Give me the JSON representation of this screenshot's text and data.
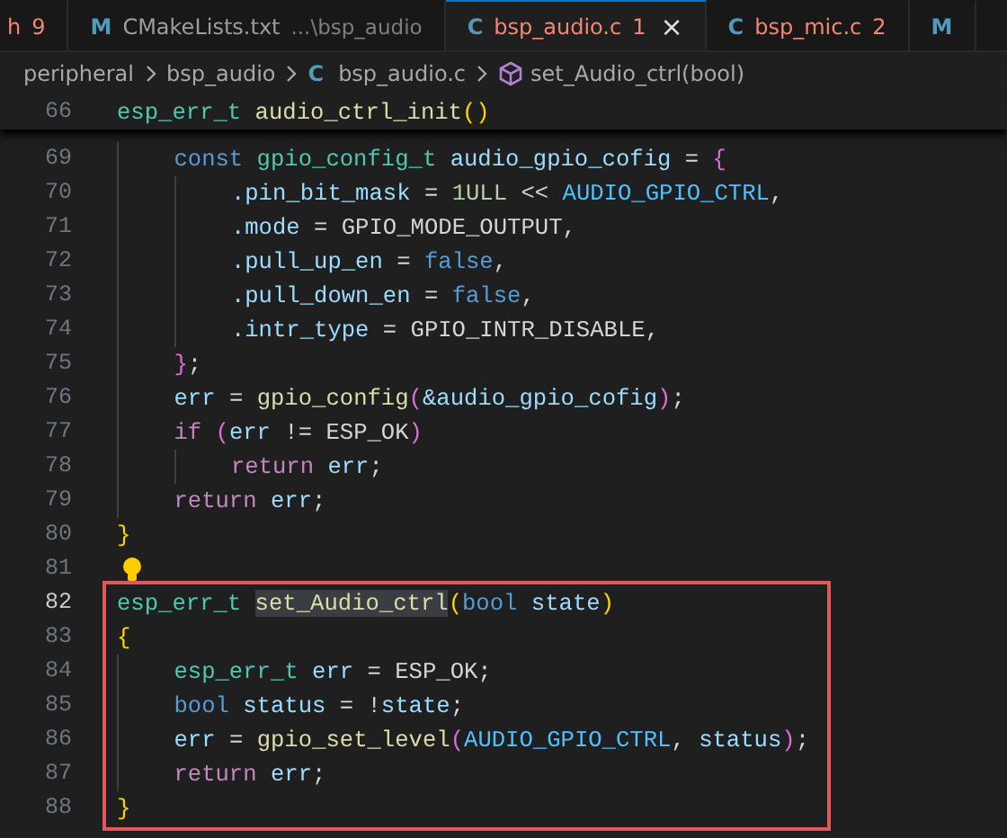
{
  "tabs": [
    {
      "label": "h",
      "badge": "9",
      "error": true,
      "selected": false
    },
    {
      "icon": "M",
      "label": "CMakeLists.txt",
      "description": "...\\bsp_audio",
      "error": false,
      "selected": false
    },
    {
      "icon": "C",
      "label": "bsp_audio.c",
      "badge": "1",
      "error": true,
      "selected": true,
      "close": "×"
    },
    {
      "icon": "C",
      "label": "bsp_mic.c",
      "badge": "2",
      "error": true,
      "selected": false
    },
    {
      "icon": "M",
      "selected": false
    }
  ],
  "breadcrumb": [
    {
      "kind": "folder",
      "label": "peripheral"
    },
    {
      "kind": "folder",
      "label": "bsp_audio"
    },
    {
      "kind": "file",
      "icon": "C",
      "label": "bsp_audio.c"
    },
    {
      "kind": "symbol",
      "label": "set_Audio_ctrl(bool)"
    }
  ],
  "sticky_line": {
    "number": "66",
    "tokens": [
      {
        "kind": "type",
        "text": "esp_err_t "
      },
      {
        "kind": "function",
        "text": "audio_ctrl_init"
      },
      {
        "kind": "bracket",
        "text": "()"
      }
    ]
  },
  "blocks": [
    {
      "kind": "plain",
      "lines": [
        {
          "number": "69",
          "current": false,
          "tokens": [
            {
              "kind": "keyword",
              "text": "    const "
            },
            {
              "kind": "type",
              "text": "gpio_config_t "
            },
            {
              "kind": "variable",
              "text": "audio_gpio_cofig"
            },
            {
              "kind": "plain",
              "text": " = "
            },
            {
              "kind": "subbracket",
              "text": "{"
            }
          ]
        },
        {
          "number": "70",
          "current": false,
          "tokens": [
            {
              "kind": "variable",
              "text": "        .pin_bit_mask"
            },
            {
              "kind": "plain",
              "text": " = "
            },
            {
              "kind": "number",
              "text": "1ULL"
            },
            {
              "kind": "plain",
              "text": " << "
            },
            {
              "kind": "macro",
              "text": "AUDIO_GPIO_CTRL"
            },
            {
              "kind": "plain",
              "text": ","
            }
          ]
        },
        {
          "number": "71",
          "current": false,
          "tokens": [
            {
              "kind": "variable",
              "text": "        .mode"
            },
            {
              "kind": "plain",
              "text": " = GPIO_MODE_OUTPUT,"
            }
          ]
        },
        {
          "number": "72",
          "current": false,
          "tokens": [
            {
              "kind": "variable",
              "text": "        .pull_up_en"
            },
            {
              "kind": "plain",
              "text": " = "
            },
            {
              "kind": "keyword",
              "text": "false"
            },
            {
              "kind": "plain",
              "text": ","
            }
          ]
        },
        {
          "number": "73",
          "current": false,
          "tokens": [
            {
              "kind": "variable",
              "text": "        .pull_down_en"
            },
            {
              "kind": "plain",
              "text": " = "
            },
            {
              "kind": "keyword",
              "text": "false"
            },
            {
              "kind": "plain",
              "text": ","
            }
          ]
        },
        {
          "number": "74",
          "current": false,
          "tokens": [
            {
              "kind": "variable",
              "text": "        .intr_type"
            },
            {
              "kind": "plain",
              "text": " = GPIO_INTR_DISABLE,"
            }
          ]
        },
        {
          "number": "75",
          "current": false,
          "tokens": [
            {
              "kind": "subbracket",
              "text": "    }"
            },
            {
              "kind": "plain",
              "text": ";"
            }
          ]
        },
        {
          "number": "76",
          "current": false,
          "tokens": [
            {
              "kind": "variable",
              "text": "    err"
            },
            {
              "kind": "plain",
              "text": " = "
            },
            {
              "kind": "function",
              "text": "gpio_config"
            },
            {
              "kind": "subbracket",
              "text": "("
            },
            {
              "kind": "variable",
              "text": "&audio_gpio_cofig"
            },
            {
              "kind": "subbracket",
              "text": ")"
            },
            {
              "kind": "plain",
              "text": ";"
            }
          ]
        },
        {
          "number": "77",
          "current": false,
          "tokens": [
            {
              "kind": "control",
              "text": "    if "
            },
            {
              "kind": "subbracket",
              "text": "("
            },
            {
              "kind": "variable",
              "text": "err"
            },
            {
              "kind": "plain",
              "text": " != ESP_OK"
            },
            {
              "kind": "subbracket",
              "text": ")"
            }
          ]
        },
        {
          "number": "78",
          "current": false,
          "tokens": [
            {
              "kind": "control",
              "text": "        return "
            },
            {
              "kind": "variable",
              "text": "err"
            },
            {
              "kind": "plain",
              "text": ";"
            }
          ]
        },
        {
          "number": "79",
          "current": false,
          "tokens": [
            {
              "kind": "control",
              "text": "    return "
            },
            {
              "kind": "variable",
              "text": "err"
            },
            {
              "kind": "plain",
              "text": ";"
            }
          ]
        },
        {
          "number": "80",
          "current": false,
          "tokens": [
            {
              "kind": "bracket",
              "text": "}"
            }
          ]
        },
        {
          "number": "81",
          "current": false,
          "lightbulb": true
        }
      ]
    },
    {
      "kind": "boxed",
      "lines": [
        {
          "number": "82",
          "current": true,
          "tokens": [
            {
              "kind": "type",
              "text": "esp_err_t "
            },
            {
              "kind": "function",
              "text": "set_Audio_ctrl",
              "highlighted": true
            },
            {
              "kind": "bracket",
              "text": "("
            },
            {
              "kind": "keyword",
              "text": "bool "
            },
            {
              "kind": "variable",
              "text": "state"
            },
            {
              "kind": "bracket",
              "text": ")"
            }
          ]
        },
        {
          "number": "83",
          "current": false,
          "tokens": [
            {
              "kind": "bracket",
              "text": "{"
            }
          ]
        },
        {
          "number": "84",
          "current": false,
          "tokens": [
            {
              "kind": "type",
              "text": "    esp_err_t "
            },
            {
              "kind": "variable",
              "text": "err"
            },
            {
              "kind": "plain",
              "text": " = ESP_OK;"
            }
          ]
        },
        {
          "number": "85",
          "current": false,
          "tokens": [
            {
              "kind": "keyword",
              "text": "    bool "
            },
            {
              "kind": "variable",
              "text": "status"
            },
            {
              "kind": "plain",
              "text": " = !"
            },
            {
              "kind": "variable",
              "text": "state"
            },
            {
              "kind": "plain",
              "text": ";"
            }
          ]
        },
        {
          "number": "86",
          "current": false,
          "tokens": [
            {
              "kind": "variable",
              "text": "    err"
            },
            {
              "kind": "plain",
              "text": " = "
            },
            {
              "kind": "function",
              "text": "gpio_set_level"
            },
            {
              "kind": "subbracket",
              "text": "("
            },
            {
              "kind": "macro",
              "text": "AUDIO_GPIO_CTRL"
            },
            {
              "kind": "plain",
              "text": ", "
            },
            {
              "kind": "variable",
              "text": "status"
            },
            {
              "kind": "subbracket",
              "text": ")"
            },
            {
              "kind": "plain",
              "text": ";"
            }
          ]
        },
        {
          "number": "87",
          "current": false,
          "tokens": [
            {
              "kind": "control",
              "text": "    return "
            },
            {
              "kind": "variable",
              "text": "err"
            },
            {
              "kind": "plain",
              "text": ";"
            }
          ]
        },
        {
          "number": "88",
          "current": false,
          "tokens": [
            {
              "kind": "bracket",
              "text": "}"
            }
          ]
        }
      ]
    }
  ]
}
